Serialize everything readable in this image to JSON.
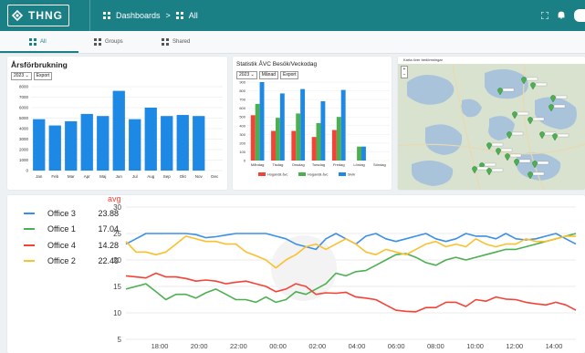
{
  "header": {
    "logo_text": "THNG",
    "breadcrumb": [
      "Dashboards",
      ">",
      "All"
    ]
  },
  "tabs": [
    {
      "label": "All",
      "active": true
    },
    {
      "label": "Groups",
      "active": false
    },
    {
      "label": "Shared",
      "active": false
    }
  ],
  "colors": {
    "header": "#1b7f86",
    "bar_blue": "#1e88e5",
    "red": "#f44336",
    "green": "#4caf50",
    "orange": "#fbc02d",
    "line_blue": "#3b8fe6"
  },
  "annual_widget": {
    "year": "2023",
    "export_label": "Export"
  },
  "avc_widget": {
    "year": "2023",
    "month_label": "Månad",
    "export_label": "Export"
  },
  "map_widget": {
    "caption": "Karta över bedömningar"
  },
  "lines_widget": {
    "avg_header": "avg",
    "offices": [
      {
        "name": "Office 3",
        "avg": "23.88",
        "color": "#3b8fe6"
      },
      {
        "name": "Office 1",
        "avg": "17.04",
        "color": "#4caf50"
      },
      {
        "name": "Office 4",
        "avg": "14.28",
        "color": "#f44336"
      },
      {
        "name": "Office 2",
        "avg": "22.49",
        "color": "#fbc02d"
      }
    ]
  },
  "chart_data": [
    {
      "type": "bar",
      "title": "Årsförbrukning",
      "categories": [
        "Jan",
        "Feb",
        "Mar",
        "Apr",
        "Maj",
        "Jun",
        "Jul",
        "Aug",
        "Sep",
        "Okt",
        "Nov",
        "Dec"
      ],
      "values": [
        4900,
        4300,
        4700,
        5400,
        5200,
        7600,
        4900,
        6000,
        5200,
        5300,
        5200,
        0
      ],
      "ylim": [
        0,
        8000
      ],
      "yticks": [
        "0",
        "1000",
        "2000",
        "3000",
        "4000",
        "5000",
        "6000",
        "7000",
        "8000"
      ]
    },
    {
      "type": "bar",
      "title": "Statistik ÅVC Besök/Veckodag",
      "categories": [
        "Måndag",
        "Tisdag",
        "Onsdag",
        "Torsdag",
        "Fredag",
        "Lördag",
        "Söndag"
      ],
      "series": [
        {
          "name": "Hogandä åvc",
          "color": "#f44336",
          "values": [
            520,
            340,
            340,
            270,
            350,
            0,
            0
          ]
        },
        {
          "name": "Hogandä åvc",
          "color": "#4caf50",
          "values": [
            650,
            490,
            540,
            430,
            500,
            160,
            0
          ]
        },
        {
          "name": "Sivik",
          "color": "#1e88e5",
          "values": [
            900,
            770,
            820,
            680,
            810,
            160,
            0
          ]
        }
      ],
      "ylim": [
        0,
        900
      ],
      "yticks": [
        "0",
        "100",
        "200",
        "300",
        "400",
        "500",
        "600",
        "700",
        "800",
        "900"
      ]
    },
    {
      "type": "line",
      "x_ticks": [
        "18:00",
        "20:00",
        "22:00",
        "00:00",
        "02:00",
        "04:00",
        "06:00",
        "08:00",
        "10:00",
        "12:00",
        "14:00",
        "16:00"
      ],
      "y_ticks": [
        "5",
        "10",
        "15",
        "20",
        "25",
        "30"
      ],
      "ylim": [
        5,
        30
      ],
      "series": [
        {
          "name": "Office 3",
          "color": "#3b8fe6",
          "values": [
            23,
            24,
            25,
            25,
            25,
            25,
            25,
            24.8,
            24.2,
            24.4,
            24.7,
            25,
            25,
            25,
            25,
            24.5,
            24,
            23,
            22.5,
            22,
            24,
            25,
            24,
            23,
            24.5,
            25,
            24,
            23.5,
            24,
            24.5,
            25,
            24,
            23.5,
            24,
            25,
            24.5,
            24.5,
            24,
            25,
            24,
            23.8,
            24,
            24.5,
            25,
            24,
            23
          ]
        },
        {
          "name": "Office 1",
          "color": "#4caf50",
          "values": [
            14.5,
            15,
            15.5,
            14,
            12.5,
            13.5,
            13.5,
            12.8,
            13.8,
            14.5,
            13.5,
            12.5,
            12.5,
            12,
            13,
            12,
            12.5,
            14,
            13.5,
            14.5,
            15.5,
            17.5,
            17,
            17.8,
            18,
            19,
            20,
            21,
            21.2,
            20.5,
            19.5,
            19,
            20,
            20.5,
            20,
            20.5,
            21,
            21.5,
            22,
            22,
            22.5,
            23,
            23.5,
            24,
            24.5,
            25
          ]
        },
        {
          "name": "Office 4",
          "color": "#f44336",
          "values": [
            17,
            16.8,
            16.6,
            17.5,
            16.8,
            16.8,
            16.5,
            16,
            16.2,
            16,
            15.5,
            15.8,
            16,
            15.5,
            15,
            14,
            14.5,
            15.5,
            15,
            13.5,
            13.8,
            13.7,
            13.9,
            13,
            12.8,
            12.5,
            11.5,
            10.5,
            10.3,
            10.2,
            11,
            11,
            12,
            12,
            11.2,
            12.5,
            12.2,
            13,
            12.6,
            12.5,
            12,
            11.7,
            11.5,
            12,
            11.5,
            10.5
          ]
        },
        {
          "name": "Office 2",
          "color": "#fbc02d",
          "values": [
            23.5,
            21.5,
            21.5,
            21,
            21.5,
            23,
            24.5,
            24,
            23.5,
            23.5,
            23,
            23,
            21.5,
            20.8,
            20,
            18.5,
            20,
            21,
            22.5,
            23,
            22,
            23,
            24,
            23,
            21.5,
            21,
            22,
            21.5,
            21,
            22,
            23,
            23.5,
            22.5,
            23,
            22.5,
            24,
            23,
            22.5,
            23,
            23,
            24,
            23.5,
            23.5,
            24,
            24.5,
            24.5
          ]
        }
      ]
    }
  ]
}
